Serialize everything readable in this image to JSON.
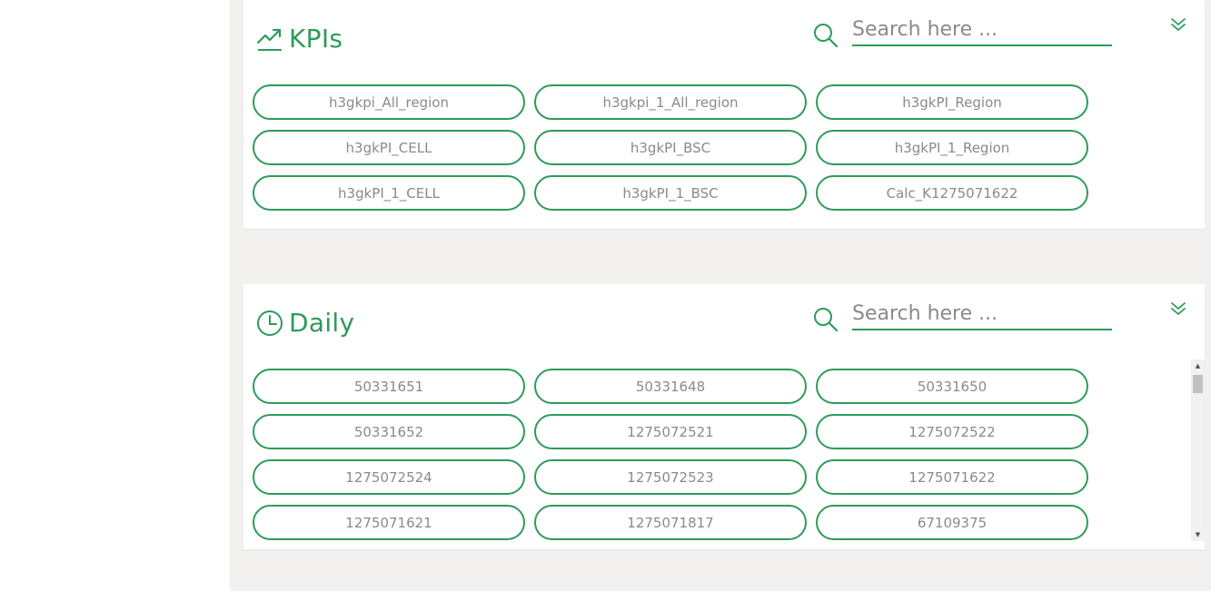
{
  "colors": {
    "accent": "#2e9b59",
    "pill_text": "#8a8a8a",
    "main_bg": "#f2f1ef"
  },
  "kpis_panel": {
    "title": "KPIs",
    "icon": "trending-up-icon",
    "search_placeholder": "Search here ...",
    "search_value": "",
    "items": [
      "h3gkpi_All_region",
      "h3gkpi_1_All_region",
      "h3gkPI_Region",
      "h3gkPI_CELL",
      "h3gkPI_BSC",
      "h3gkPI_1_Region",
      "h3gkPI_1_CELL",
      "h3gkPI_1_BSC",
      "Calc_K1275071622"
    ]
  },
  "daily_panel": {
    "title": "Daily",
    "icon": "clock-icon",
    "search_placeholder": "Search here ...",
    "search_value": "",
    "items": [
      "50331651",
      "50331648",
      "50331650",
      "50331652",
      "1275072521",
      "1275072522",
      "1275072524",
      "1275072523",
      "1275071622",
      "1275071621",
      "1275071817",
      "67109375"
    ]
  }
}
